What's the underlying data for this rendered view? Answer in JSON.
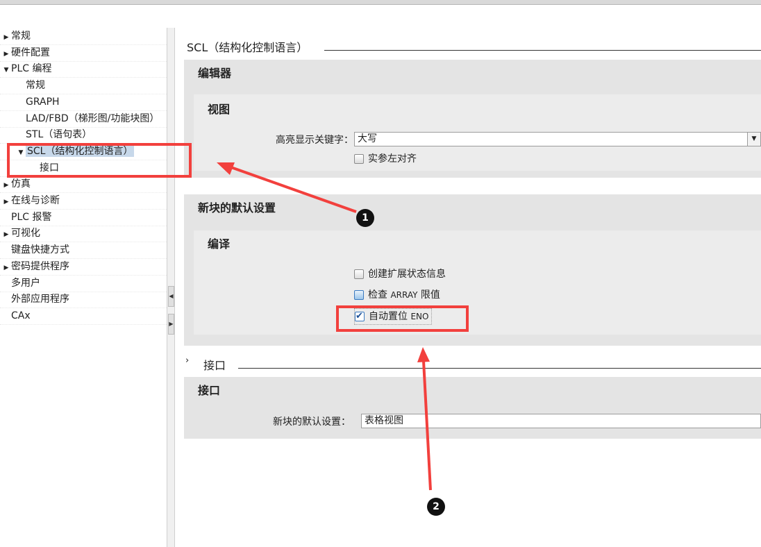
{
  "sidebar": {
    "items": [
      {
        "label": "常规",
        "arrow": "▶",
        "level": 0
      },
      {
        "label": "硬件配置",
        "arrow": "▶",
        "level": 0
      },
      {
        "label": "PLC 编程",
        "arrow": "▼",
        "level": 0
      },
      {
        "label": "常规",
        "arrow": "",
        "level": 1
      },
      {
        "label": "GRAPH",
        "arrow": "",
        "level": 1
      },
      {
        "label": "LAD/FBD（梯形图/功能块图）",
        "arrow": "",
        "level": 1
      },
      {
        "label": "STL（语句表）",
        "arrow": "",
        "level": 1
      },
      {
        "label": "SCL（结构化控制语言）",
        "arrow": "▼",
        "level": 1,
        "selected": true
      },
      {
        "label": "接口",
        "arrow": "",
        "level": 2
      },
      {
        "label": "仿真",
        "arrow": "▶",
        "level": 0
      },
      {
        "label": "在线与诊断",
        "arrow": "▶",
        "level": 0
      },
      {
        "label": "PLC 报警",
        "arrow": "",
        "level": 0
      },
      {
        "label": "可视化",
        "arrow": "▶",
        "level": 0
      },
      {
        "label": "键盘快捷方式",
        "arrow": "",
        "level": 0
      },
      {
        "label": "密码提供程序",
        "arrow": "▶",
        "level": 0
      },
      {
        "label": "多用户",
        "arrow": "",
        "level": 0
      },
      {
        "label": "外部应用程序",
        "arrow": "",
        "level": 0
      },
      {
        "label": "CAx",
        "arrow": "",
        "level": 0
      }
    ]
  },
  "splitter": {
    "collapse_left": "◀",
    "collapse_right": "▶"
  },
  "main": {
    "section_title": "SCL（结构化控制语言）",
    "editor": {
      "title": "编辑器",
      "view": {
        "title": "视图",
        "highlight_label": "高亮显示关键字：",
        "highlight_value": "大写",
        "align_label": "实参左对齐",
        "align_checked": false
      }
    },
    "defaults": {
      "title": "新块的默认设置",
      "compile": {
        "title": "编译",
        "opt1": "创建扩展状态信息",
        "opt2_prefix": "检查 ",
        "opt2_mono": "ARRAY",
        "opt2_suffix": " 限值",
        "opt3_prefix": "自动置位 ",
        "opt3_mono": "ENO",
        "opt3_checked": true
      }
    },
    "interface_section": {
      "chevron": "›",
      "title": "接口",
      "panel_title": "接口",
      "field_label": "新块的默认设置：",
      "field_value": "表格视图"
    }
  },
  "annotations": {
    "badge1": "1",
    "badge2": "2",
    "color": "#f2403d"
  }
}
